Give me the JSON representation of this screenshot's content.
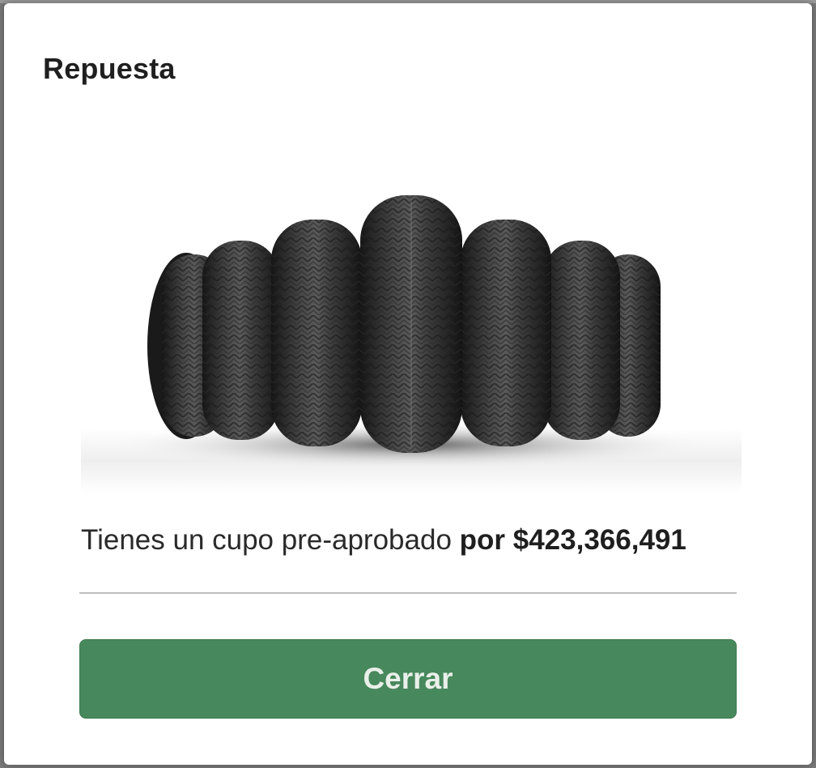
{
  "modal": {
    "title": "Repuesta",
    "hero_image": "tires-image",
    "message_prefix": "Tienes un cupo pre-aprobado",
    "message_amount": "por $423,366,491",
    "close_label": "Cerrar"
  },
  "colors": {
    "primary": "#47885c",
    "button_text": "#e9efe9",
    "overlay": "#6f6f6f"
  }
}
